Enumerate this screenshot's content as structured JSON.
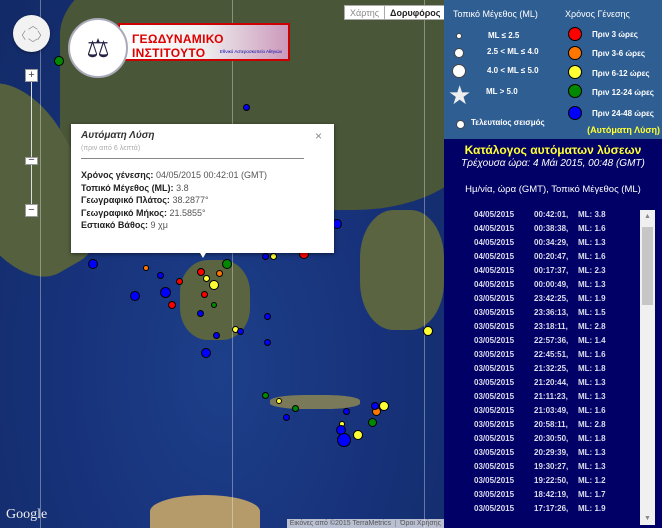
{
  "map": {
    "map_type_buttons": [
      "Χάρτης",
      "Δορυφόρος"
    ],
    "logo": {
      "title": "ΓΕΩΔΥΝΑΜΙΚΟ ΙΝΣΤΙΤΟΥΤΟ",
      "subtitle": "Εθνικό Αστεροσκοπείο Αθηνών"
    },
    "zoom_in": "+",
    "zoom_out": "−",
    "popup": {
      "title": "Αυτόματη Λύση",
      "subtitle": "(πριν από 6 λεπτά)",
      "fields": [
        {
          "label": "Χρόνος γένεσης:",
          "value": "04/05/2015 00:42:01 (GMT)"
        },
        {
          "label": "Τοπικό Μέγεθος (ML):",
          "value": "3.8"
        },
        {
          "label": "Γεωγραφικό Πλάτος:",
          "value": "38.2877°"
        },
        {
          "label": "Γεωγραφικό Μήκος:",
          "value": "21.5855°"
        },
        {
          "label": "Εστιακό Βάθος:",
          "value": "9 χμ"
        }
      ],
      "close": "×"
    },
    "google": "Google",
    "attribution": "Εικόνες από ©2015 TerraMetrics",
    "terms": "Όροι Χρήσης"
  },
  "legend": {
    "size_title": "Τοπικό Μέγεθος (ML)",
    "sizes": [
      "ML ≤ 2.5",
      "2.5 < ML ≤ 4.0",
      "4.0 < ML ≤ 5.0",
      "ML > 5.0"
    ],
    "last_quake": "Τελευταίος σεισμός",
    "time_title": "Χρόνος Γένεσης",
    "times": [
      {
        "label": "Πριν 3 ώρες",
        "color": "#ff0000"
      },
      {
        "label": "Πριν 3-6 ώρες",
        "color": "#ff7700"
      },
      {
        "label": "Πριν 6-12 ώρες",
        "color": "#ffff33"
      },
      {
        "label": "Πριν 12-24 ώρες",
        "color": "#008800"
      },
      {
        "label": "Πριν 24-48 ώρες",
        "color": "#0000ff"
      }
    ],
    "auto_note": "(Αυτόματη Λύση)"
  },
  "catalog": {
    "title": "Κατάλογος αυτόματων λύσεων",
    "current_time": "Τρέχουσα ώρα: 4 Μάι 2015, 00:48 (GMT)",
    "column_header": "Ημ/νία, ώρα (GMT), Τοπικό Μέγεθος (ML)",
    "items": [
      [
        "04/05/2015",
        "00:42:01,",
        "ML: 3.8"
      ],
      [
        "04/05/2015",
        "00:38:38,",
        "ML: 1.6"
      ],
      [
        "04/05/2015",
        "00:34:29,",
        "ML: 1.3"
      ],
      [
        "04/05/2015",
        "00:20:47,",
        "ML: 1.6"
      ],
      [
        "04/05/2015",
        "00:17:37,",
        "ML: 2.3"
      ],
      [
        "04/05/2015",
        "00:00:49,",
        "ML: 1.3"
      ],
      [
        "03/05/2015",
        "23:42:25,",
        "ML: 1.9"
      ],
      [
        "03/05/2015",
        "23:36:13,",
        "ML: 1.5"
      ],
      [
        "03/05/2015",
        "23:18:11,",
        "ML: 2.8"
      ],
      [
        "03/05/2015",
        "22:57:36,",
        "ML: 1.4"
      ],
      [
        "03/05/2015",
        "22:45:51,",
        "ML: 1.6"
      ],
      [
        "03/05/2015",
        "21:32:25,",
        "ML: 1.8"
      ],
      [
        "03/05/2015",
        "21:20:44,",
        "ML: 1.3"
      ],
      [
        "03/05/2015",
        "21:11:23,",
        "ML: 1.3"
      ],
      [
        "03/05/2015",
        "21:03:49,",
        "ML: 1.6"
      ],
      [
        "03/05/2015",
        "20:58:11,",
        "ML: 2.8"
      ],
      [
        "03/05/2015",
        "20:30:50,",
        "ML: 1.8"
      ],
      [
        "03/05/2015",
        "20:29:39,",
        "ML: 1.3"
      ],
      [
        "03/05/2015",
        "19:30:27,",
        "ML: 1.3"
      ],
      [
        "03/05/2015",
        "19:22:50,",
        "ML: 1.2"
      ],
      [
        "03/05/2015",
        "18:42:19,",
        "ML: 1.7"
      ],
      [
        "03/05/2015",
        "17:17:26,",
        "ML: 1.9"
      ]
    ]
  }
}
